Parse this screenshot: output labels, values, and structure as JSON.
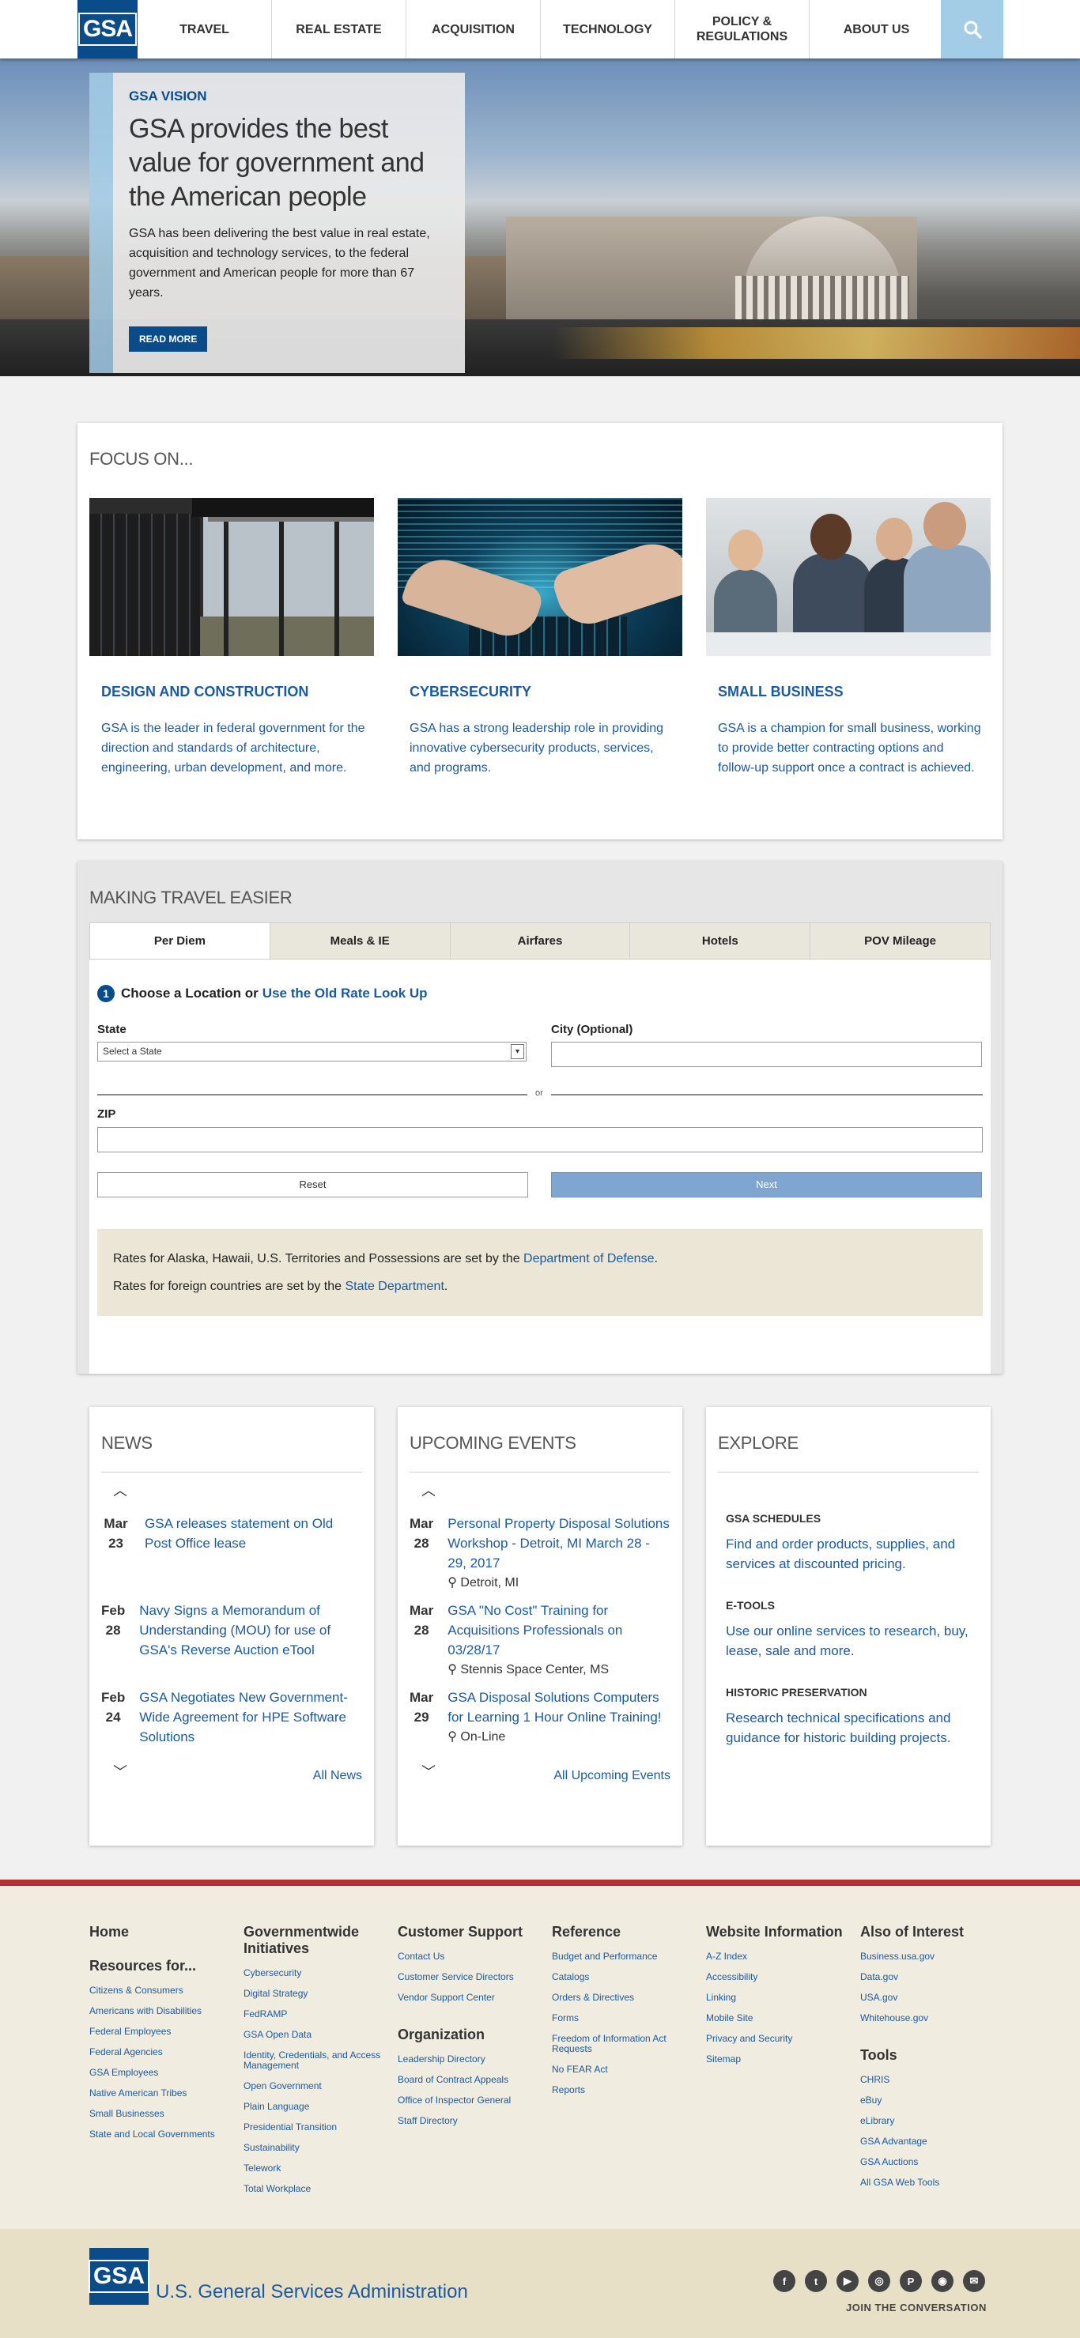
{
  "nav": {
    "logo": "GSA",
    "items": [
      "TRAVEL",
      "REAL ESTATE",
      "ACQUISITION",
      "TECHNOLOGY",
      "POLICY & REGULATIONS",
      "ABOUT US"
    ],
    "search_icon": "search-icon"
  },
  "hero": {
    "kicker": "GSA VISION",
    "title": "GSA provides the best value for government and the American people",
    "body": "GSA has been delivering the best value in real estate, acquisition and technology services, to the federal government and American people for more than 67 years.",
    "button": "READ MORE"
  },
  "focus": {
    "title": "FOCUS ON...",
    "items": [
      {
        "title": "DESIGN AND CONSTRUCTION",
        "text": "GSA is the leader in federal government for the direction and standards of architecture, engineering, urban development, and more."
      },
      {
        "title": "CYBERSECURITY",
        "text": "GSA has a strong leadership role in providing innovative cybersecurity products, services, and programs."
      },
      {
        "title": "SMALL BUSINESS",
        "text": "GSA is a champion for small business, working to provide better contracting options and follow-up support once a contract is achieved."
      }
    ]
  },
  "travel": {
    "title": "MAKING TRAVEL EASIER",
    "tabs": [
      "Per Diem",
      "Meals & IE",
      "Airfares",
      "Hotels",
      "POV Mileage"
    ],
    "step_number": "1",
    "step_text": "Choose a Location or ",
    "step_link": "Use the Old Rate Look Up",
    "state_label": "State",
    "state_select": "Select a State",
    "city_label": "City (Optional)",
    "or": "or",
    "zip_label": "ZIP",
    "reset": "Reset",
    "next": "Next",
    "rates_line1_prefix": "Rates for Alaska, Hawaii, U.S. Territories and Possessions are set by the ",
    "rates_line1_link": "Department of Defense",
    "rates_line1_suffix": ".",
    "rates_line2_prefix": "Rates for foreign countries are set by the ",
    "rates_line2_link": "State Department",
    "rates_line2_suffix": "."
  },
  "news": {
    "title": "NEWS",
    "items": [
      {
        "month": "Mar",
        "day": "23",
        "text": "GSA releases statement on Old Post Office lease"
      },
      {
        "month": "Feb",
        "day": "28",
        "text": "Navy Signs a Memorandum of Understanding (MOU) for use of GSA's Reverse Auction eTool"
      },
      {
        "month": "Feb",
        "day": "24",
        "text": "GSA Negotiates New Government-Wide Agreement for HPE Software Solutions"
      }
    ],
    "more": "All News"
  },
  "events": {
    "title": "UPCOMING EVENTS",
    "items": [
      {
        "month": "Mar",
        "day": "28",
        "text": "Personal Property Disposal Solutions Workshop - Detroit, MI March 28 - 29, 2017",
        "loc": "Detroit, MI"
      },
      {
        "month": "Mar",
        "day": "28",
        "text": "GSA \"No Cost\" Training for Acquisitions Professionals on 03/28/17",
        "loc": "Stennis Space Center, MS"
      },
      {
        "month": "Mar",
        "day": "29",
        "text": "GSA Disposal Solutions Computers for Learning 1 Hour Online Training!",
        "loc": "On-Line"
      }
    ],
    "more": "All Upcoming Events"
  },
  "explore": {
    "title": "EXPLORE",
    "items": [
      {
        "title": "GSA SCHEDULES",
        "text": "Find and order products, supplies, and services at discounted pricing."
      },
      {
        "title": "E-TOOLS",
        "text": "Use our online services to research, buy, lease, sale and more."
      },
      {
        "title": "HISTORIC PRESERVATION",
        "text": "Research technical specifications and guidance for historic building projects."
      }
    ]
  },
  "footer": {
    "home": "Home",
    "resources_title": "Resources for...",
    "resources": [
      "Citizens & Consumers",
      "Americans with Disabilities",
      "Federal Employees",
      "Federal Agencies",
      "GSA Employees",
      "Native American Tribes",
      "Small Businesses",
      "State and Local Governments"
    ],
    "gov_title": "Governmentwide Initiatives",
    "gov": [
      "Cybersecurity",
      "Digital Strategy",
      "FedRAMP",
      "GSA Open Data",
      "Identity, Credentials, and Access Management",
      "Open Government",
      "Plain Language",
      "Presidential Transition",
      "Sustainability",
      "Telework",
      "Total Workplace"
    ],
    "support_title": "Customer Support",
    "support": [
      "Contact Us",
      "Customer Service Directors",
      "Vendor Support Center"
    ],
    "org_title": "Organization",
    "org": [
      "Leadership Directory",
      "Board of Contract Appeals",
      "Office of Inspector General",
      "Staff Directory"
    ],
    "ref_title": "Reference",
    "ref": [
      "Budget and Performance",
      "Catalogs",
      "Orders & Directives",
      "Forms",
      "Freedom of Information Act Requests",
      "No FEAR Act",
      "Reports"
    ],
    "web_title": "Website Information",
    "web": [
      "A-Z Index",
      "Accessibility",
      "Linking",
      "Mobile Site",
      "Privacy and Security",
      "Sitemap"
    ],
    "also_title": "Also of Interest",
    "also": [
      "Business.usa.gov",
      "Data.gov",
      "USA.gov",
      "Whitehouse.gov"
    ],
    "tools_title": "Tools",
    "tools": [
      "CHRIS",
      "eBuy",
      "eLibrary",
      "GSA Advantage",
      "GSA Auctions",
      "All GSA Web Tools"
    ]
  },
  "bottom": {
    "logo": "GSA",
    "agency": "U.S. General Services Administration",
    "social": [
      "f",
      "t",
      "▶",
      "◎",
      "P",
      "◉",
      "✉"
    ],
    "join": "JOIN THE CONVERSATION"
  }
}
